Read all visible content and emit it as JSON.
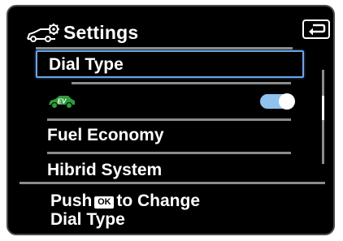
{
  "header": {
    "title": "Settings",
    "icon": "car-settings-icon"
  },
  "back_button": {
    "icon": "return-arrow-icon"
  },
  "menu": {
    "items": [
      {
        "label": "Dial Type",
        "selected": true
      },
      {
        "label": "",
        "icon": "ev-icon",
        "icon_text": "EV",
        "toggle": "on"
      },
      {
        "label": "Fuel Economy"
      },
      {
        "label": "Hibrid System"
      }
    ]
  },
  "hint": {
    "push": "Push",
    "ok_badge": "OK",
    "to_change": "to Change",
    "line2": "Dial Type"
  },
  "colors": {
    "background": "#000000",
    "text": "#ffffff",
    "selection_border": "#6aa6e6",
    "toggle_on": "#8fc2ec",
    "ev_icon_green": "#2e9a3a",
    "divider": "#8c8c8c"
  }
}
